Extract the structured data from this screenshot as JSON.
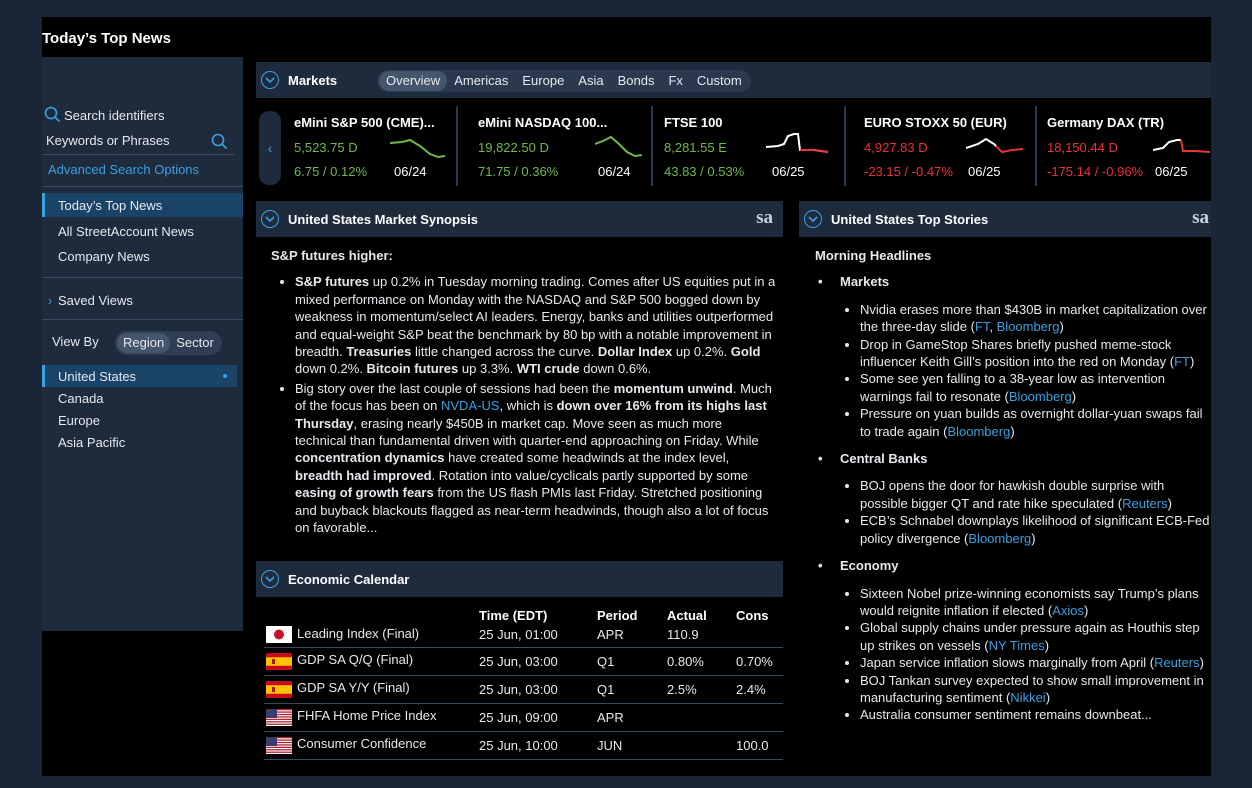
{
  "app": {
    "title": "Today’s Top News"
  },
  "sidebar": {
    "search_label": "Search identifiers",
    "keywords_placeholder": "Keywords or Phrases",
    "advanced": "Advanced Search Options",
    "nav": [
      "Today’s Top News",
      "All StreetAccount News",
      "Company News"
    ],
    "saved_views": "Saved Views",
    "view_by": "View By",
    "view_options": [
      "Region",
      "Sector"
    ],
    "regions": [
      "United States",
      "Canada",
      "Europe",
      "Asia Pacific"
    ]
  },
  "markets": {
    "title": "Markets",
    "tabs": [
      "Overview",
      "Americas",
      "Europe",
      "Asia",
      "Bonds",
      "Fx",
      "Custom"
    ],
    "tickers": [
      {
        "name": "eMini S&P 500 (CME)...",
        "price": "5,523.75 D",
        "change": "6.75 / 0.12%",
        "date": "06/24"
      },
      {
        "name": "eMini NASDAQ 100...",
        "price": "19,822.50 D",
        "change": "71.75 / 0.36%",
        "date": "06/24"
      },
      {
        "name": "FTSE 100",
        "price": "8,281.55 E",
        "change": "43.83 / 0.53%",
        "date": "06/25"
      },
      {
        "name": "EURO STOXX 50 (EUR)",
        "price": "4,927.83 D",
        "change": "-23.15 / -0.47%",
        "date": "06/25"
      },
      {
        "name": "Germany DAX (TR)",
        "price": "18,150.44 D",
        "change": "-175.14 / -0.96%",
        "date": "06/25"
      }
    ],
    "colors": {
      "up": "#6fb94a",
      "down": "#e8323c"
    }
  },
  "synopsis": {
    "title": "United States Market Synopsis",
    "logo": "sa",
    "heading": "S&P futures higher:",
    "p1": [
      {
        "b": "S&P futures"
      },
      {
        "t": " up 0.2% in Tuesday morning trading. Comes after US equities put in a mixed performance on Monday with the NASDAQ and S&P 500 bogged down by weakness in momentum/select AI leaders. Energy, banks and utilities outperformed and equal-weight S&P beat the benchmark by 80 bp with a notable improvement in breadth. "
      },
      {
        "b": "Treasuries"
      },
      {
        "t": " little changed across the curve. "
      },
      {
        "b": "Dollar Index"
      },
      {
        "t": " up 0.2%. "
      },
      {
        "b": "Gold"
      },
      {
        "t": " down 0.2%. "
      },
      {
        "b": "Bitcoin futures"
      },
      {
        "t": " up 3.3%. "
      },
      {
        "b": "WTI crude"
      },
      {
        "t": " down 0.6%."
      }
    ],
    "p2": [
      {
        "t": "Big story over the last couple of sessions had been the "
      },
      {
        "b": "momentum unwind"
      },
      {
        "t": ". Much of the focus has been on "
      },
      {
        "l": "NVDA-US"
      },
      {
        "t": ", which is "
      },
      {
        "b": "down over 16% from its highs last Thursday"
      },
      {
        "t": ", erasing nearly $450B in market cap. Move seen as much more technical than fundamental driven with quarter-end approaching on Friday. While "
      },
      {
        "b": "concentration dynamics"
      },
      {
        "t": " have created some headwinds at the index level, "
      },
      {
        "b": "breadth had improved"
      },
      {
        "t": ". Rotation into value/cyclicals partly supported by some "
      },
      {
        "b": "easing of growth fears"
      },
      {
        "t": " from the US flash PMIs last Friday. Stretched positioning and buyback blackouts flagged as near-term headwinds, though also a lot of focus on favorable..."
      }
    ]
  },
  "calendar": {
    "title": "Economic Calendar",
    "headers": [
      "Time (EDT)",
      "Period",
      "Actual",
      "Cons"
    ],
    "rows": [
      {
        "flag": "jp",
        "event": "Leading Index (Final)",
        "time": "25 Jun, 01:00",
        "period": "APR",
        "actual": "110.9",
        "cons": ""
      },
      {
        "flag": "es",
        "event": "GDP SA Q/Q (Final)",
        "time": "25 Jun, 03:00",
        "period": "Q1",
        "actual": "0.80%",
        "cons": "0.70%"
      },
      {
        "flag": "es",
        "event": "GDP SA Y/Y (Final)",
        "time": "25 Jun, 03:00",
        "period": "Q1",
        "actual": "2.5%",
        "cons": "2.4%"
      },
      {
        "flag": "us",
        "event": "FHFA Home Price Index",
        "time": "25 Jun, 09:00",
        "period": "APR",
        "actual": "",
        "cons": ""
      },
      {
        "flag": "us",
        "event": "Consumer Confidence",
        "time": "25 Jun, 10:00",
        "period": "JUN",
        "actual": "",
        "cons": "100.0"
      }
    ]
  },
  "top_stories": {
    "title": "United States Top Stories",
    "logo": "sa",
    "heading": "Morning Headlines",
    "sections": [
      {
        "name": "Markets",
        "items": [
          {
            "text": "Nvidia erases more than $430B in market capitalization over the three-day slide (",
            "links": [
              "FT",
              "Bloomberg"
            ]
          },
          {
            "text": "Drop in GameStop Shares briefly pushed meme-stock influencer Keith Gill’s position into the red on Monday (",
            "links": [
              "FT"
            ]
          },
          {
            "text": "Some see yen falling to a 38-year low as intervention warnings fail to resonate (",
            "links": [
              "Bloomberg"
            ]
          },
          {
            "text": "Pressure on yuan builds as overnight dollar-yuan swaps fail to trade again (",
            "links": [
              "Bloomberg"
            ]
          }
        ]
      },
      {
        "name": "Central Banks",
        "items": [
          {
            "text": "BOJ opens the door for hawkish double surprise with possible bigger QT and rate hike speculated (",
            "links": [
              "Reuters"
            ]
          },
          {
            "text": "ECB’s Schnabel downplays likelihood of significant ECB-Fed policy divergence (",
            "links": [
              "Bloomberg"
            ]
          }
        ]
      },
      {
        "name": "Economy",
        "items": [
          {
            "text": "Sixteen Nobel prize-winning economists say Trump’s plans would reignite inflation if elected (",
            "links": [
              "Axios"
            ]
          },
          {
            "text": "Global supply chains under pressure again as Houthis step up strikes on vessels (",
            "links": [
              "NY Times"
            ]
          },
          {
            "text": "Japan service inflation slows marginally from April (",
            "links": [
              "Reuters"
            ]
          },
          {
            "text": "BOJ Tankan survey expected to show small improvement in manufacturing sentiment (",
            "links": [
              "Nikkei"
            ]
          },
          {
            "text": "Australia consumer sentiment remains downbeat...",
            "links": []
          }
        ]
      }
    ]
  }
}
